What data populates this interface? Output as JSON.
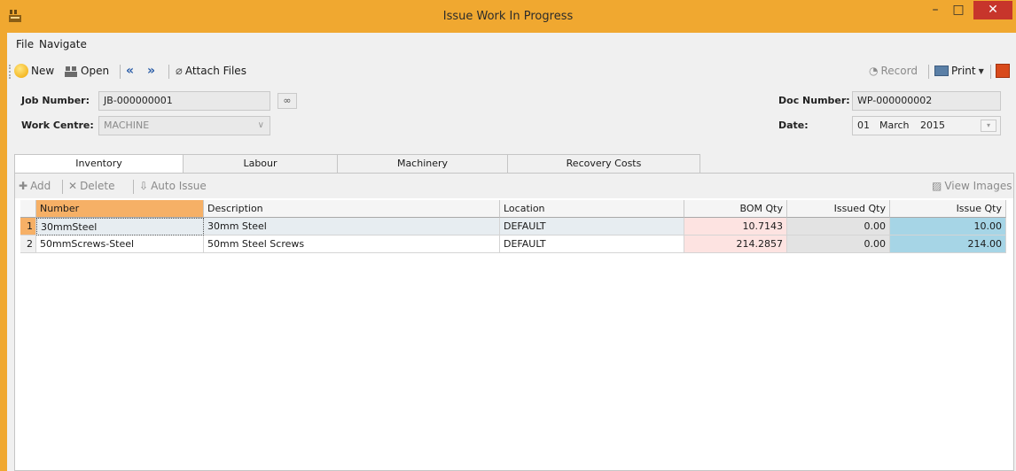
{
  "window": {
    "title": "Issue Work In Progress",
    "controls": {
      "minimize": "–",
      "maximize": "□",
      "close": "✕"
    }
  },
  "menu": {
    "file": "File",
    "navigate": "Navigate"
  },
  "toolbar": {
    "new": "New",
    "open": "Open",
    "prev_glyph": "«",
    "next_glyph": "»",
    "attach": "Attach Files",
    "record": "Record",
    "print": "Print"
  },
  "form": {
    "job_number_label": "Job Number:",
    "job_number_value": "JB-000000001",
    "work_centre_label": "Work Centre:",
    "work_centre_value": "MACHINE",
    "doc_number_label": "Doc Number:",
    "doc_number_value": "WP-000000002",
    "date_label": "Date:",
    "date_day": "01",
    "date_month": "March",
    "date_year": "2015"
  },
  "tabs": [
    {
      "label": "Inventory",
      "active": true
    },
    {
      "label": "Labour",
      "active": false
    },
    {
      "label": "Machinery",
      "active": false
    },
    {
      "label": "Recovery Costs",
      "active": false
    }
  ],
  "grid_toolbar": {
    "add": "Add",
    "delete": "Delete",
    "auto_issue": "Auto Issue",
    "view_images": "View Images"
  },
  "grid": {
    "columns": [
      "Number",
      "Description",
      "Location",
      "BOM Qty",
      "Issued Qty",
      "Issue Qty"
    ],
    "rows": [
      {
        "n": "1",
        "number": "30mmSteel",
        "description": "30mm Steel",
        "location": "DEFAULT",
        "bom": "10.7143",
        "issued": "0.00",
        "issue": "10.00"
      },
      {
        "n": "2",
        "number": "50mmScrews-Steel",
        "description": "50mm Steel Screws",
        "location": "DEFAULT",
        "bom": "214.2857",
        "issued": "0.00",
        "issue": "214.00"
      }
    ]
  },
  "colors": {
    "window_frame": "#f0a830",
    "close_button": "#c7352b",
    "sorted_header": "#f6b066",
    "bom_cell": "#fde3e1",
    "issue_cell": "#a6d5e6"
  },
  "icons": {
    "app": "cash-register-icon",
    "new": "sun-icon",
    "open": "binoculars-icon",
    "attach": "paperclip-icon",
    "record": "record-icon",
    "print": "printer-icon",
    "calendar": "calendar-icon",
    "lookup": "binoculars-icon"
  }
}
